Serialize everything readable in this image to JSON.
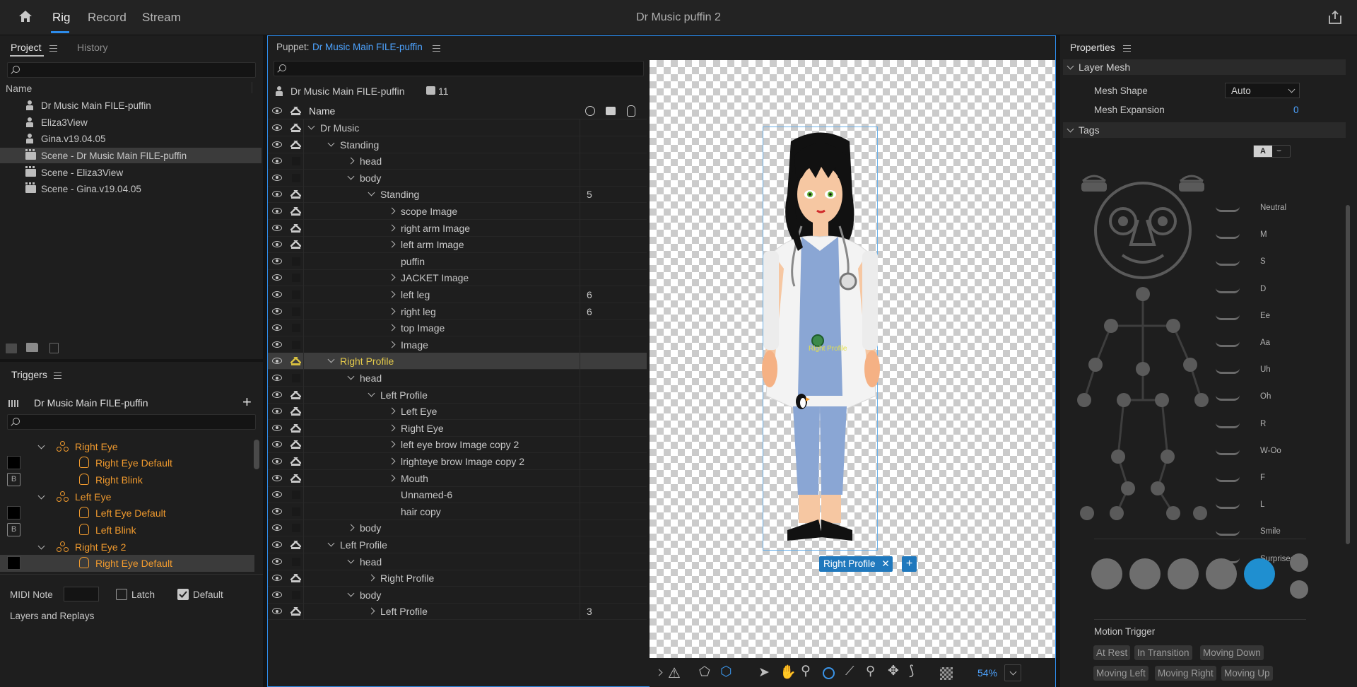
{
  "topbar": {
    "modes": [
      "Rig",
      "Record",
      "Stream"
    ],
    "active_mode": "Rig",
    "document_title": "Dr Music puffin 2"
  },
  "project_panel": {
    "tabs": [
      "Project",
      "History"
    ],
    "column_header": "Name",
    "items": [
      {
        "label": "Dr Music Main FILE-puffin",
        "type": "puppet"
      },
      {
        "label": "Eliza3View",
        "type": "puppet"
      },
      {
        "label": "Gina.v19.04.05",
        "type": "puppet"
      },
      {
        "label": "Scene - Dr Music Main FILE-puffin",
        "type": "scene"
      },
      {
        "label": "Scene - Eliza3View",
        "type": "scene"
      },
      {
        "label": "Scene - Gina.v19.04.05",
        "type": "scene"
      }
    ]
  },
  "triggers_panel": {
    "title": "Triggers",
    "puppet_name": "Dr Music Main FILE-puffin",
    "rows": [
      {
        "label": "Right Eye",
        "kind": "group"
      },
      {
        "label": "Right Eye Default",
        "kind": "trigger"
      },
      {
        "label": "Right Blink",
        "kind": "trigger",
        "key": "B"
      },
      {
        "label": "Left Eye",
        "kind": "group"
      },
      {
        "label": "Left Eye Default",
        "kind": "trigger"
      },
      {
        "label": "Left Blink",
        "kind": "trigger",
        "key": "B"
      },
      {
        "label": "Right Eye 2",
        "kind": "group"
      },
      {
        "label": "Right Eye Default",
        "kind": "trigger"
      }
    ],
    "midi_note_label": "MIDI Note",
    "latch_label": "Latch",
    "default_label": "Default",
    "layers_replays_label": "Layers and Replays"
  },
  "puppet_panel": {
    "label_prefix": "Puppet:",
    "puppet_name": "Dr Music Main FILE-puffin",
    "root_name": "Dr Music Main FILE-puffin",
    "root_count": "11",
    "name_header": "Name",
    "layers": [
      {
        "name": "Dr Music",
        "level": 0,
        "exp": "down",
        "crown": true
      },
      {
        "name": "Standing",
        "level": 1,
        "exp": "down",
        "crown": true
      },
      {
        "name": "head",
        "level": 2,
        "exp": "right",
        "crown": false
      },
      {
        "name": "body",
        "level": 2,
        "exp": "down",
        "crown": false
      },
      {
        "name": "Standing",
        "level": 3,
        "exp": "down",
        "crown": true,
        "num": "5"
      },
      {
        "name": "scope Image",
        "level": 4,
        "exp": "right",
        "crown": true
      },
      {
        "name": "right arm Image",
        "level": 4,
        "exp": "right",
        "crown": true
      },
      {
        "name": "left arm Image",
        "level": 4,
        "exp": "right",
        "crown": true
      },
      {
        "name": "puffin",
        "level": 4,
        "exp": "",
        "crown": false
      },
      {
        "name": "JACKET Image",
        "level": 4,
        "exp": "right",
        "crown": false
      },
      {
        "name": "left leg",
        "level": 4,
        "exp": "right",
        "crown": false,
        "num": "6"
      },
      {
        "name": "right leg",
        "level": 4,
        "exp": "right",
        "crown": false,
        "num": "6"
      },
      {
        "name": "top Image",
        "level": 4,
        "exp": "right",
        "crown": false
      },
      {
        "name": "Image",
        "level": 4,
        "exp": "right",
        "crown": false
      },
      {
        "name": "Right Profile",
        "level": 1,
        "exp": "down",
        "crown": true,
        "selected": true
      },
      {
        "name": "head",
        "level": 2,
        "exp": "down",
        "crown": false
      },
      {
        "name": "Left Profile",
        "level": 3,
        "exp": "down",
        "crown": true
      },
      {
        "name": "Left Eye",
        "level": 4,
        "exp": "right",
        "crown": true
      },
      {
        "name": "Right Eye",
        "level": 4,
        "exp": "right",
        "crown": true
      },
      {
        "name": "left eye brow Image copy 2",
        "level": 4,
        "exp": "right",
        "crown": true
      },
      {
        "name": "lrighteye brow Image copy 2",
        "level": 4,
        "exp": "right",
        "crown": true
      },
      {
        "name": "Mouth",
        "level": 4,
        "exp": "right",
        "crown": true
      },
      {
        "name": "Unnamed-6",
        "level": 4,
        "exp": "",
        "crown": false
      },
      {
        "name": "hair copy",
        "level": 4,
        "exp": "",
        "crown": false
      },
      {
        "name": "body",
        "level": 2,
        "exp": "right",
        "crown": false
      },
      {
        "name": "Left Profile",
        "level": 1,
        "exp": "down",
        "crown": true
      },
      {
        "name": "head",
        "level": 2,
        "exp": "down",
        "crown": false
      },
      {
        "name": "Right Profile",
        "level": 3,
        "exp": "right",
        "crown": true
      },
      {
        "name": "body",
        "level": 2,
        "exp": "down",
        "crown": false
      },
      {
        "name": "Left Profile",
        "level": 3,
        "exp": "right",
        "crown": true,
        "num": "3"
      }
    ],
    "canvas_handle_label": "Right Profile",
    "canvas_tag_label": "Right Profile",
    "zoom": "54%"
  },
  "properties_panel": {
    "title": "Properties",
    "layer_mesh_section": "Layer Mesh",
    "mesh_shape_label": "Mesh Shape",
    "mesh_shape_value": "Auto",
    "mesh_expansion_label": "Mesh Expansion",
    "mesh_expansion_value": "0",
    "tags_section": "Tags",
    "tag_mode_text": "A",
    "visemes": [
      "Neutral",
      "M",
      "S",
      "D",
      "Ee",
      "Aa",
      "Uh",
      "Oh",
      "R",
      "W-Oo",
      "F",
      "L",
      "Smile",
      "Surprised"
    ],
    "motion_trigger_label": "Motion Trigger",
    "motion_tags": [
      "At Rest",
      "In Transition",
      "Moving Down",
      "Moving Left",
      "Moving Right",
      "Moving Up"
    ]
  },
  "colors": {
    "accent": "#2d8ceb",
    "trigger_orange": "#f09a2e",
    "selected_layer_gold": "#e3c94a",
    "link_blue": "#4da3ff"
  }
}
